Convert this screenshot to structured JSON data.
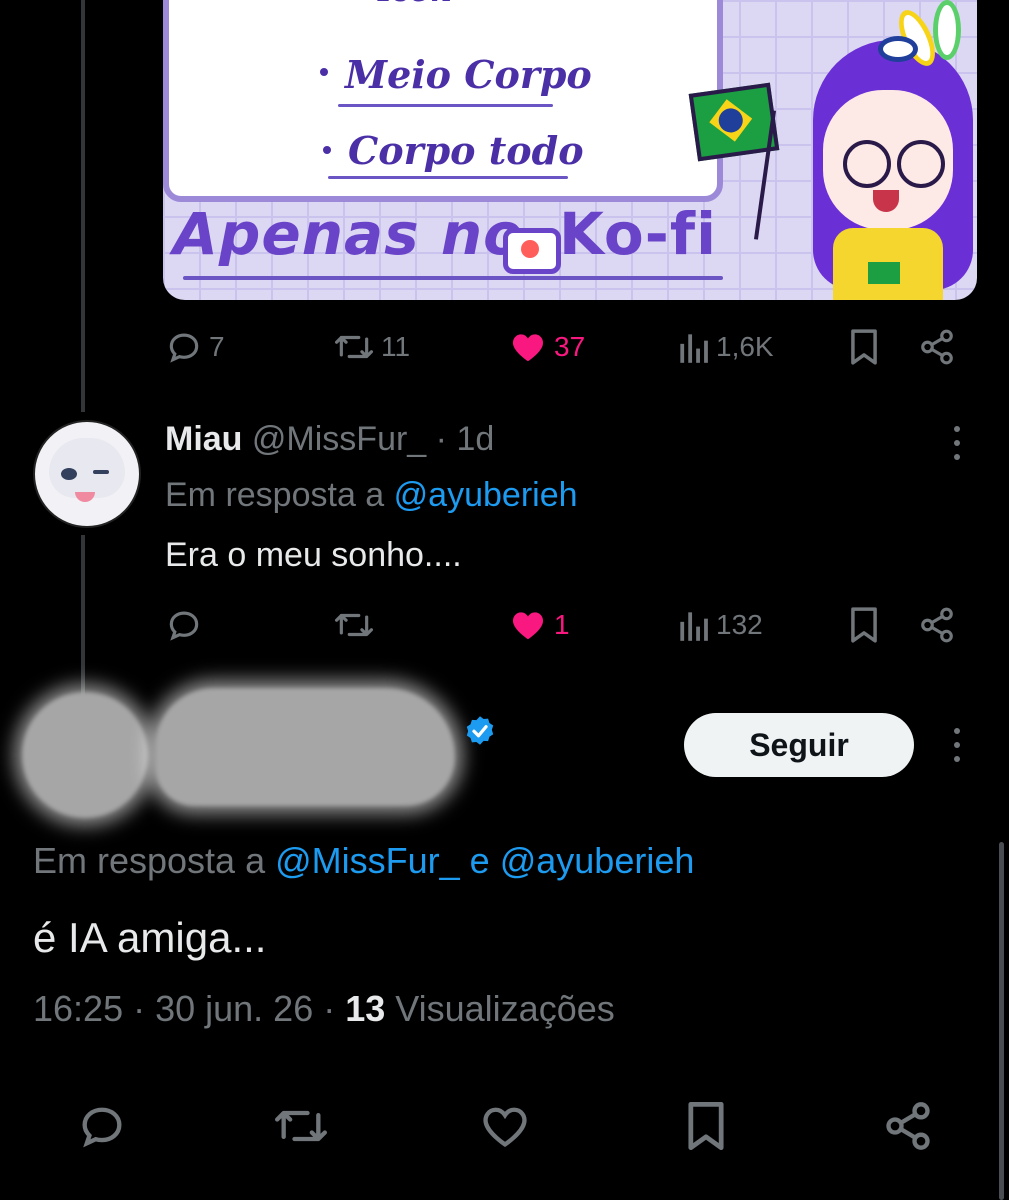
{
  "colors": {
    "background": "#000000",
    "text": "#e7e9ea",
    "muted": "#71767b",
    "link": "#1d9bf0",
    "like": "#f91880",
    "follow_button_bg": "#eff3f4"
  },
  "promo_image": {
    "items": [
      "Icon",
      "Meio Corpo",
      "Corpo todo"
    ],
    "footer_text": "Apenas no",
    "brand": "Ko-fi"
  },
  "tweet1_actions": {
    "replies": "7",
    "reposts": "11",
    "likes": "37",
    "views": "1,6K",
    "liked": true
  },
  "reply1": {
    "name": "Miau",
    "handle": "@MissFur_",
    "time": "· 1d",
    "replying_prefix": "Em resposta a",
    "replying_to": "@ayuberieh",
    "text": "Era o meu sonho....",
    "replies": "",
    "reposts": "",
    "likes": "1",
    "views": "132",
    "liked": true
  },
  "main_tweet": {
    "verified": true,
    "follow_label": "Seguir",
    "replying_prefix": "Em resposta a",
    "replying_to": "@MissFur_ e @ayuberieh",
    "text": "é IA amiga...",
    "time": "16:25 · 30 jun. 26 ·",
    "views_count": "13",
    "views_label": "Visualizações"
  }
}
